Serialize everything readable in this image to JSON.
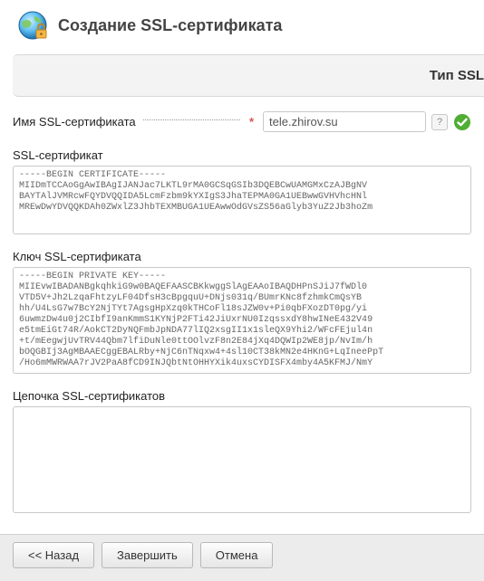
{
  "header": {
    "title": "Создание SSL-сертификата"
  },
  "type_bar": {
    "label": "Тип SSL"
  },
  "name_field": {
    "label": "Имя SSL-сертификата",
    "value": "tele.zhirov.su",
    "help": "?"
  },
  "cert_section": {
    "label": "SSL-сертификат",
    "value": "-----BEGIN CERTIFICATE-----\nMIIDmTCCAoGgAwIBAgIJANJac7LKTL9rMA0GCSqGSIb3DQEBCwUAMGMxCzAJBgNV\nBAYTAlJVMRcwFQYDVQQIDA5LcmFzbm9kYXIgS3JhaTEPMA0GA1UEBwwGVHVhcHNl\nMREwDwYDVQQKDAh0ZWxlZ3JhbTEXMBUGA1UEAwwOdGVsZS56aGlyb3YuZ2Jb3hoZm"
  },
  "key_section": {
    "label": "Ключ SSL-сертификата",
    "value": "-----BEGIN PRIVATE KEY-----\nMIIEvwIBADANBgkqhkiG9w0BAQEFAASCBKkwggSlAgEAAoIBAQDHPnSJiJ7fWDl0\nVTD5V+Jh2LzqaFhtzyLF04DfsH3cBpgquU+DNjs031q/BUmrKNc8fzhmkCmQsYB\nhh/U4LsG7w7BcY2NjTYt7AgsgHpXzq0kTHCoFl18sJZW0v+Pi0qbFXozDT0pg/yi\n6uwmzDw4u0j2CIbfI9anKmmS1KYNjP2FTi42JiUxrNU0IzqssxdY8hwINeE432V49\ne5tmEiGt74R/AokCT2DyNQFmbJpNDA77lIQ2xsgII1x1sleQX9Yhi2/WFcFEjul4n\n+t/mEegwjUvTRV44Qbm7lfiDuNle0ttOOlvzF8n2E84jXq4DQWIp2WE8jp/NvIm/h\nbOQGBIj3AgMBAAECggEBALRby+NjC6nTNqxw4+4sl10CT38kMN2e4HKnG+LqIneePpT\n/Ho6mMWRWAA7rJV2PaA8fCD9INJQbtNtOHHYXik4uxsCYDISFX4mby4A5KFMJ/NmY"
  },
  "chain_section": {
    "label": "Цепочка SSL-сертификатов",
    "value": ""
  },
  "footer": {
    "back": "<< Назад",
    "finish": "Завершить",
    "cancel": "Отмена"
  }
}
